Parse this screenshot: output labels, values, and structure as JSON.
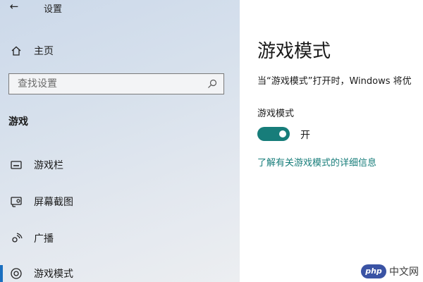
{
  "window": {
    "title": "设置",
    "back_icon": "←"
  },
  "sidebar": {
    "home": {
      "icon": "home-icon",
      "label": "主页"
    },
    "search": {
      "placeholder": "查找设置",
      "icon": "search-icon"
    },
    "section_heading": "游戏",
    "items": [
      {
        "icon": "game-bar-icon",
        "label": "游戏栏"
      },
      {
        "icon": "screen-capture-icon",
        "label": "屏幕截图"
      },
      {
        "icon": "broadcast-icon",
        "label": "广播"
      },
      {
        "icon": "game-mode-icon",
        "label": "游戏模式",
        "selected": true
      }
    ]
  },
  "main": {
    "title": "游戏模式",
    "description": "当“游戏模式”打开时，Windows 将优",
    "setting": {
      "label": "游戏模式",
      "toggle_on": true,
      "state_text": "开"
    },
    "learn_more_link": "了解有关游戏模式的详细信息"
  },
  "colors": {
    "accent": "#177d7a",
    "selected_indicator": "#1a6fc0"
  },
  "watermark": {
    "logo_text": "php",
    "text": "中文网"
  }
}
